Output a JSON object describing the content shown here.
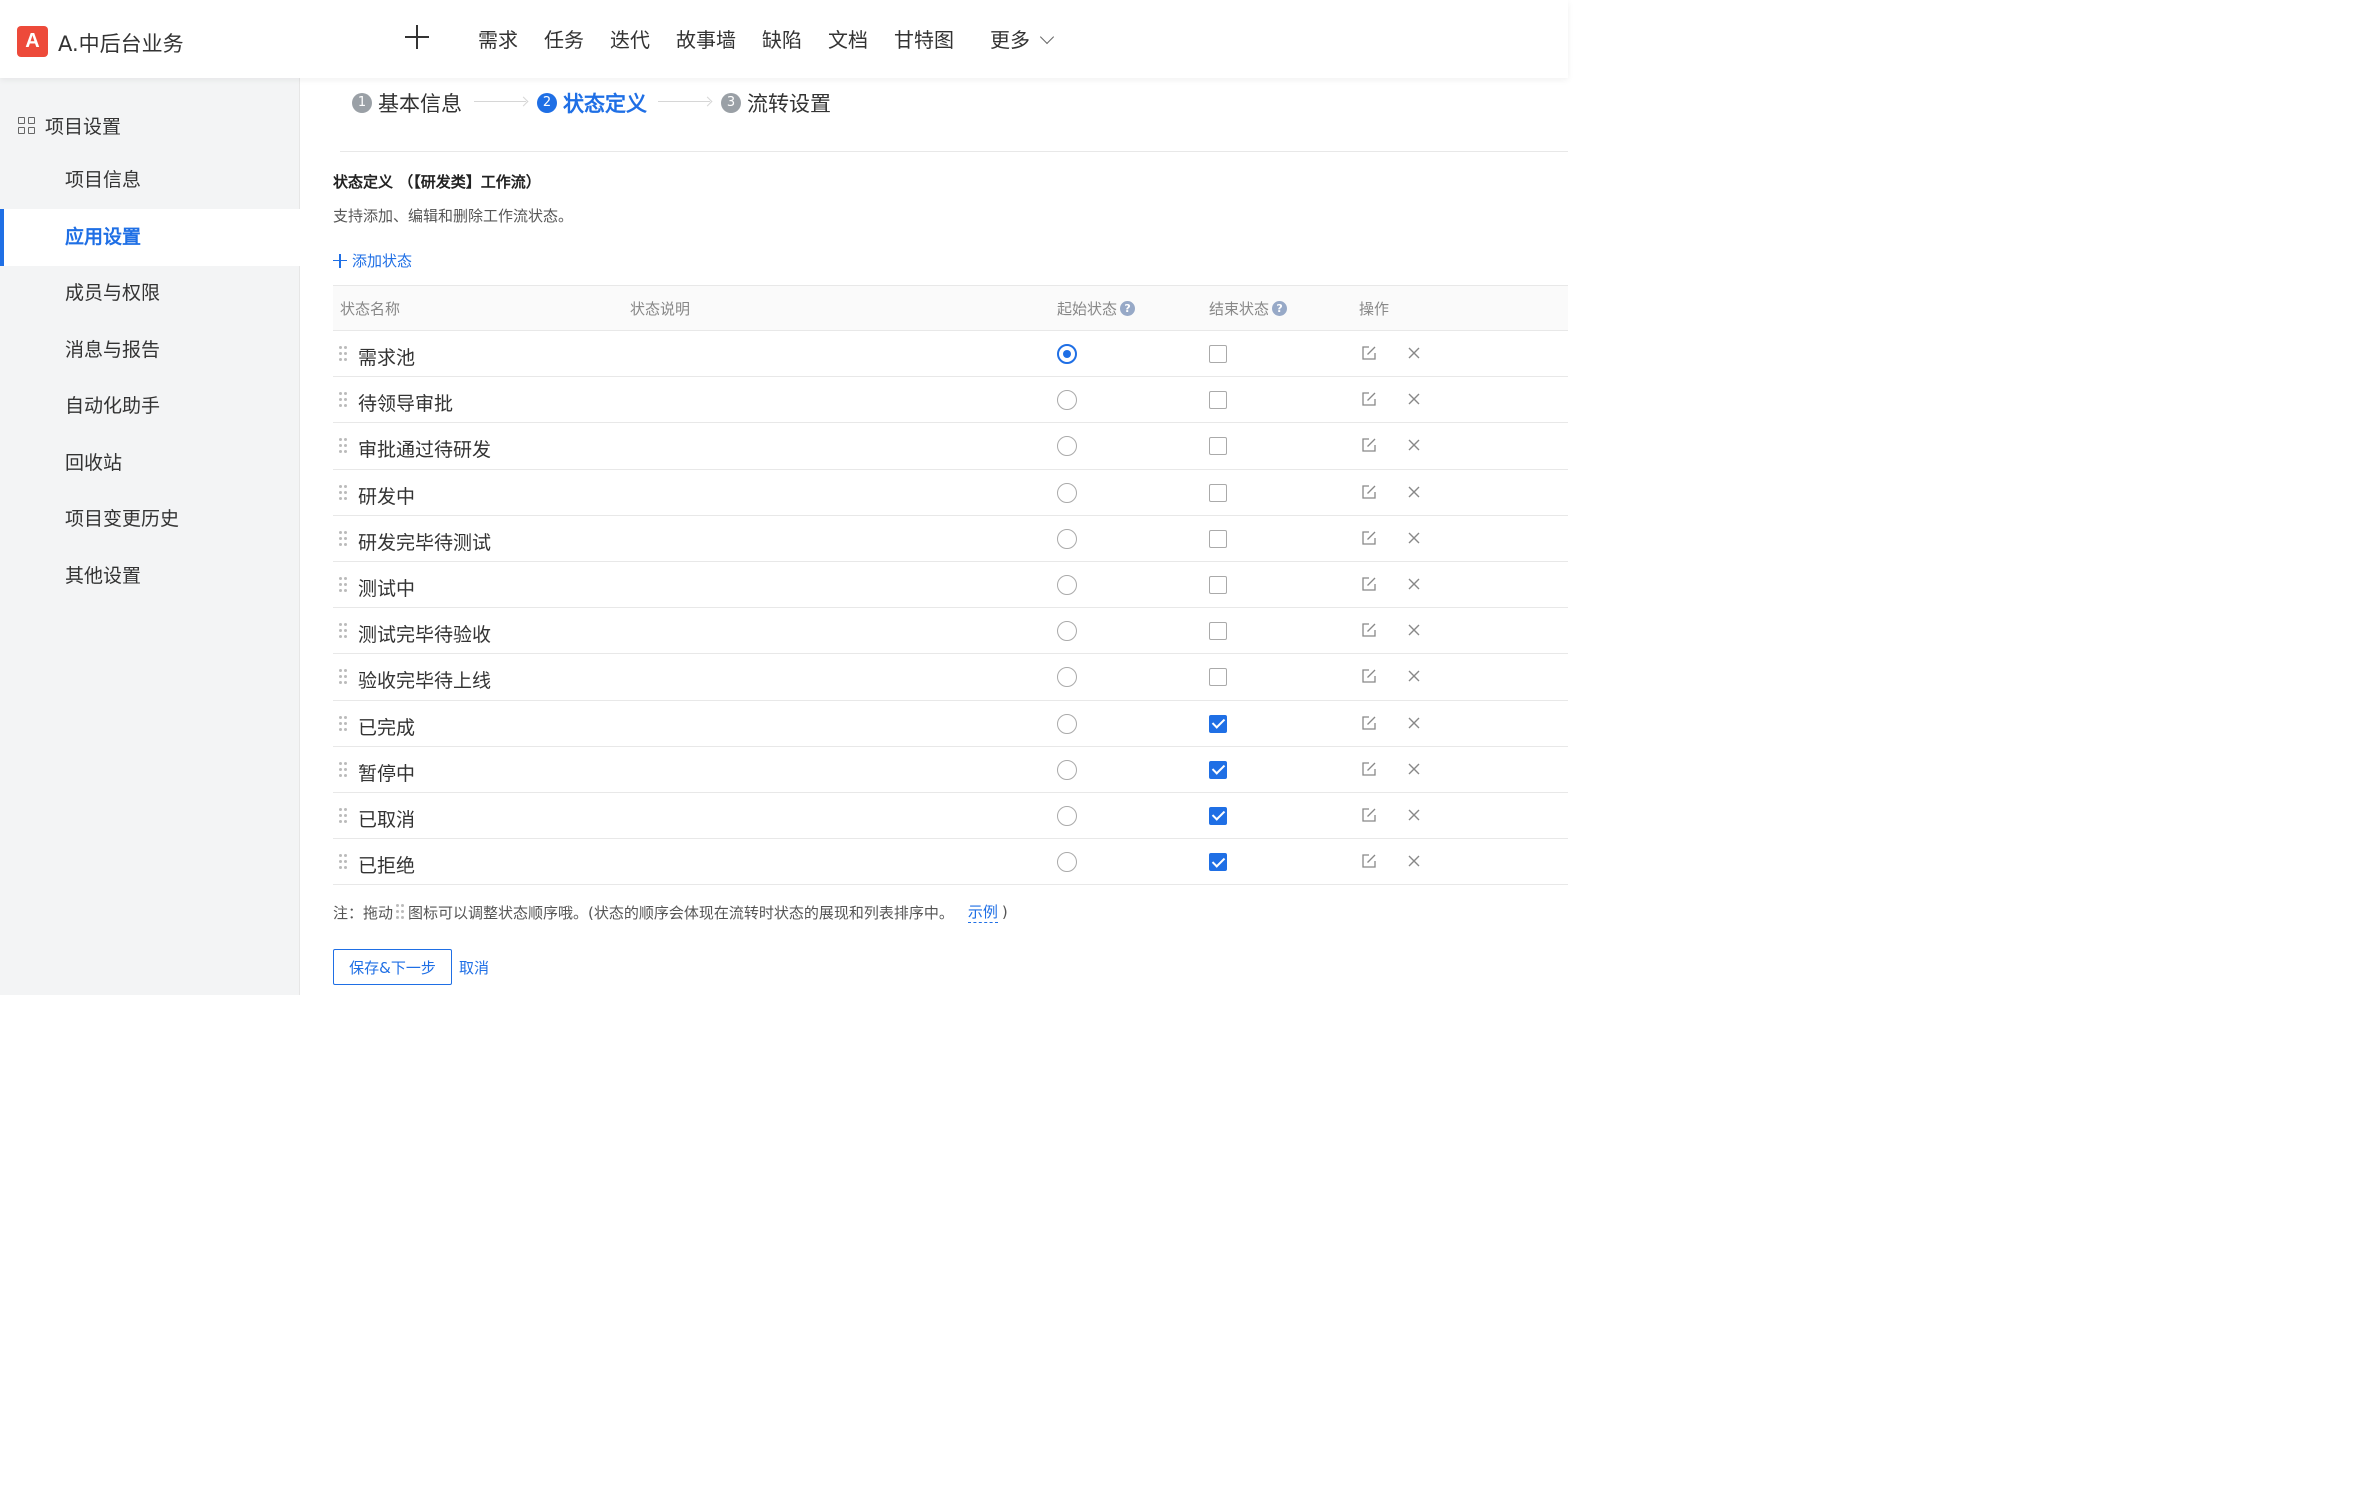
{
  "app": {
    "logo_letter": "A",
    "name": "A.中后台业务"
  },
  "topnav": {
    "items": [
      "需求",
      "任务",
      "迭代",
      "故事墙",
      "缺陷",
      "文档",
      "甘特图"
    ],
    "more_label": "更多"
  },
  "sidebar": {
    "heading": "项目设置",
    "items": [
      "项目信息",
      "应用设置",
      "成员与权限",
      "消息与报告",
      "自动化助手",
      "回收站",
      "项目变更历史",
      "其他设置"
    ],
    "active_index": 1
  },
  "steps": [
    {
      "num": "1",
      "label": "基本信息"
    },
    {
      "num": "2",
      "label": "状态定义"
    },
    {
      "num": "3",
      "label": "流转设置"
    }
  ],
  "section": {
    "title": "状态定义 （【研发类】工作流）",
    "description": "支持添加、编辑和删除工作流状态。",
    "add_label": "添加状态"
  },
  "table": {
    "headers": {
      "name": "状态名称",
      "desc": "状态说明",
      "start": "起始状态",
      "end": "结束状态",
      "ops": "操作"
    },
    "rows": [
      {
        "name": "需求池",
        "start": true,
        "end": false
      },
      {
        "name": "待领导审批",
        "start": false,
        "end": false
      },
      {
        "name": "审批通过待研发",
        "start": false,
        "end": false
      },
      {
        "name": "研发中",
        "start": false,
        "end": false
      },
      {
        "name": "研发完毕待测试",
        "start": false,
        "end": false
      },
      {
        "name": "测试中",
        "start": false,
        "end": false
      },
      {
        "name": "测试完毕待验收",
        "start": false,
        "end": false
      },
      {
        "name": "验收完毕待上线",
        "start": false,
        "end": false
      },
      {
        "name": "已完成",
        "start": false,
        "end": true
      },
      {
        "name": "暂停中",
        "start": false,
        "end": true
      },
      {
        "name": "已取消",
        "start": false,
        "end": true
      },
      {
        "name": "已拒绝",
        "start": false,
        "end": true
      }
    ]
  },
  "note": {
    "prefix": "注：拖动",
    "text": "图标可以调整状态顺序哦。(状态的顺序会体现在流转时状态的展现和列表排序中。",
    "link": "示例",
    "suffix": ")"
  },
  "actions": {
    "save_next": "保存&下一步",
    "cancel": "取消"
  },
  "colors": {
    "accent": "#1f6fe5",
    "logo": "#ed4a3a",
    "sidebar_bg": "#f3f4f5"
  }
}
